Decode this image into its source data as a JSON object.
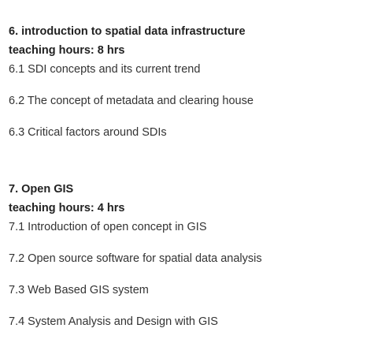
{
  "sections": [
    {
      "heading": "6. introduction to spatial data infrastructure",
      "hours": "teaching hours: 8 hrs",
      "items": [
        "6.1 SDI concepts and its current trend",
        "6.2 The concept of metadata and clearing house",
        "6.3 Critical factors around SDIs"
      ]
    },
    {
      "heading": "7. Open GIS",
      "hours": "teaching hours: 4 hrs",
      "items": [
        "7.1 Introduction of open concept in GIS",
        "7.2 Open source software for spatial data analysis",
        "7.3 Web Based GIS system",
        "7.4 System Analysis and Design with GIS"
      ]
    }
  ]
}
